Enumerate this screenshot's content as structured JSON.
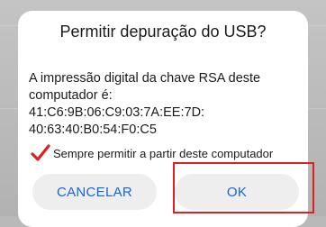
{
  "dialog": {
    "title": "Permitir depuração do USB?",
    "message_line1": "A impressão digital da chave RSA deste",
    "message_line2": "computador é:",
    "fingerprint_line1": "41:C6:9B:06:C9:03:7A:EE:7D:",
    "fingerprint_line2": "40:63:40:B0:54:F0:C5",
    "checkbox": {
      "label": "Sempre permitir a partir deste computador",
      "checked": true,
      "check_color": "#e02020"
    },
    "cancel_label": "CANCELAR",
    "ok_label": "OK",
    "button_text_color": "#1565d8",
    "highlight_color": "#e02020"
  }
}
